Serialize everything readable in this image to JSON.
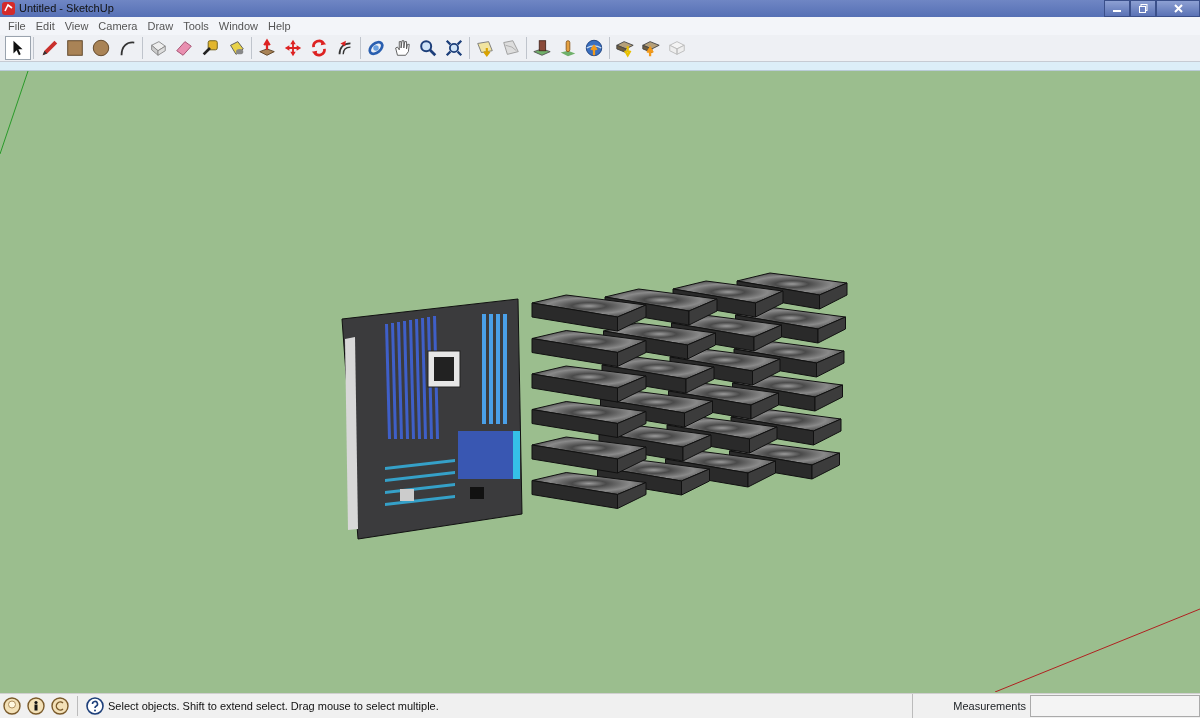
{
  "window": {
    "title": "Untitled - SketchUp"
  },
  "menu": [
    "File",
    "Edit",
    "View",
    "Camera",
    "Draw",
    "Tools",
    "Window",
    "Help"
  ],
  "toolbar": [
    {
      "kind": "select",
      "selected": true
    },
    {
      "kind": "sep"
    },
    {
      "kind": "pencil",
      "selected": false
    },
    {
      "kind": "rectangle",
      "selected": false
    },
    {
      "kind": "circle",
      "selected": false
    },
    {
      "kind": "arc",
      "selected": false
    },
    {
      "kind": "sep"
    },
    {
      "kind": "component",
      "selected": false
    },
    {
      "kind": "eraser",
      "selected": false
    },
    {
      "kind": "tape",
      "selected": false
    },
    {
      "kind": "bucket",
      "selected": false
    },
    {
      "kind": "sep"
    },
    {
      "kind": "pushpull",
      "selected": false
    },
    {
      "kind": "move",
      "selected": false
    },
    {
      "kind": "rotate",
      "selected": false
    },
    {
      "kind": "offset",
      "selected": false
    },
    {
      "kind": "sep"
    },
    {
      "kind": "orbit",
      "selected": false
    },
    {
      "kind": "pan",
      "selected": false
    },
    {
      "kind": "zoom",
      "selected": false
    },
    {
      "kind": "extents",
      "selected": false
    },
    {
      "kind": "sep"
    },
    {
      "kind": "getimage",
      "selected": false
    },
    {
      "kind": "terrain",
      "selected": false
    },
    {
      "kind": "sep"
    },
    {
      "kind": "building",
      "selected": false
    },
    {
      "kind": "pin",
      "selected": false
    },
    {
      "kind": "globe",
      "selected": false
    },
    {
      "kind": "sep"
    },
    {
      "kind": "boxdown",
      "selected": false
    },
    {
      "kind": "boxup",
      "selected": false
    },
    {
      "kind": "boxgrey",
      "selected": false
    }
  ],
  "status_bar": {
    "text": "Select objects. Shift to extend select. Drag mouse to select multiple.",
    "measurements_label": "Measurements"
  }
}
